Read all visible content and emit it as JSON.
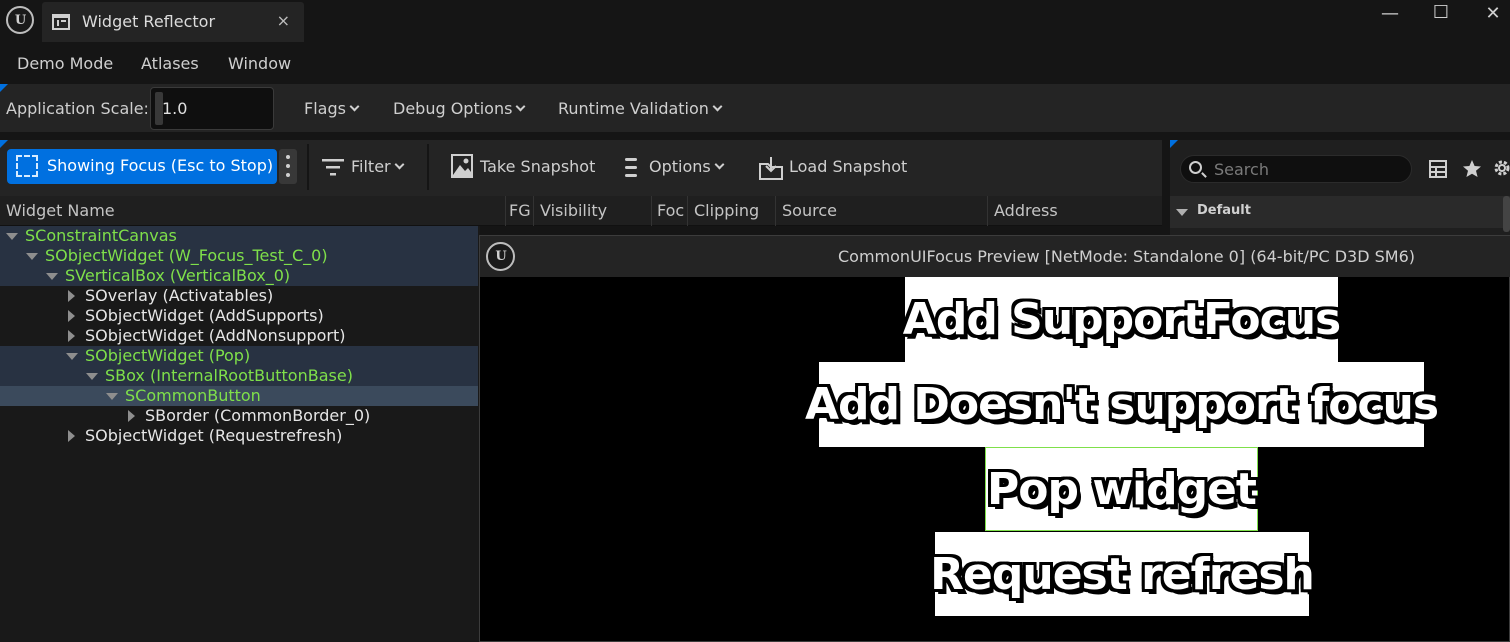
{
  "window": {
    "tab_title": "Widget Reflector",
    "tab_close": "×",
    "minimize": "—",
    "maximize": "☐",
    "close": "✕"
  },
  "menu": [
    "Demo Mode",
    "Atlases",
    "Window"
  ],
  "scale": {
    "label": "Application Scale:",
    "value": "1.0",
    "flags": "Flags",
    "debug_options": "Debug Options",
    "runtime_validation": "Runtime Validation"
  },
  "toolbar": {
    "focus_button": "Showing Focus (Esc to Stop)",
    "filter": "Filter",
    "take_snapshot": "Take Snapshot",
    "options": "Options",
    "load_snapshot": "Load Snapshot"
  },
  "tree": {
    "columns": [
      "Widget Name",
      "FG",
      "Visibility",
      "Foc",
      "Clipping",
      "Source",
      "Address"
    ],
    "rows": [
      {
        "label": "SConstraintCanvas",
        "highlight": "focus-path"
      },
      {
        "label": "SObjectWidget (W_Focus_Test_C_0)",
        "highlight": "focus-path"
      },
      {
        "label": "SVerticalBox (VerticalBox_0)",
        "highlight": "focus-path"
      },
      {
        "label": "SOverlay (Activatables)",
        "highlight": "none"
      },
      {
        "label": "SObjectWidget (AddSupports)",
        "highlight": "none"
      },
      {
        "label": "SObjectWidget (AddNonsupport)",
        "highlight": "none"
      },
      {
        "label": "SObjectWidget (Pop)",
        "highlight": "focus-path"
      },
      {
        "label": "SBox (InternalRootButtonBase)",
        "highlight": "focus-path"
      },
      {
        "label": "SCommonButton",
        "highlight": "focused"
      },
      {
        "label": "SBorder (CommonBorder_0)",
        "highlight": "none"
      },
      {
        "label": "SObjectWidget (Requestrefresh)",
        "highlight": "none"
      }
    ]
  },
  "details": {
    "search_placeholder": "Search",
    "category": "Default"
  },
  "preview": {
    "title": "CommonUIFocus Preview [NetMode: Standalone 0]  (64-bit/PC D3D SM6)",
    "buttons": [
      {
        "label": "Add SupportFocus",
        "focused": false
      },
      {
        "label": "Add Doesn't support focus",
        "focused": false
      },
      {
        "label": "Pop widget",
        "focused": true
      },
      {
        "label": "Request refresh",
        "focused": false
      }
    ]
  },
  "colors": {
    "focus_green": "#7fe04a",
    "accent_blue": "#0070e0",
    "selected_row": "#3b4a5c",
    "focus_path_row": "#283242"
  }
}
